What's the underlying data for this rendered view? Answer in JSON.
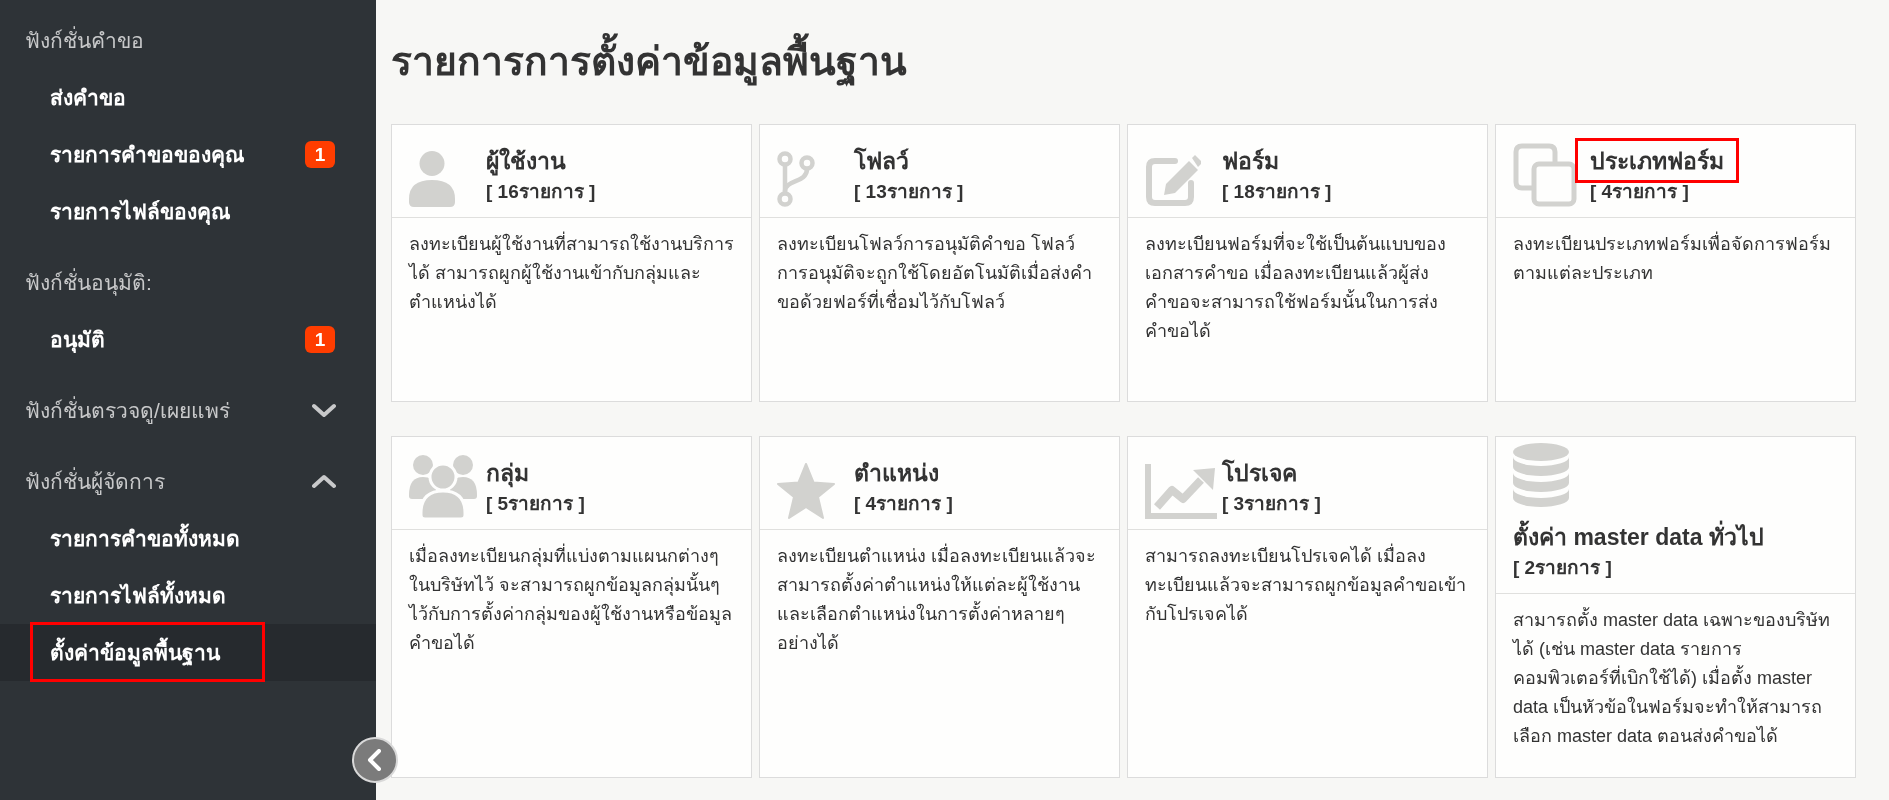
{
  "sidebar": {
    "sections": [
      {
        "kind": "plain",
        "heading": "ฟังก์ชั่นคำขอ",
        "items": [
          {
            "label": "ส่งคำขอ",
            "selected": false,
            "highlighted": false
          },
          {
            "label": "รายการคำขอของคุณ",
            "badge": "1",
            "selected": false,
            "highlighted": false
          },
          {
            "label": "รายการไฟล์ของคุณ",
            "selected": false,
            "highlighted": false
          }
        ]
      },
      {
        "kind": "plain",
        "heading": "ฟังก์ชั่นอนุมัติ:",
        "items": [
          {
            "label": "อนุมัติ",
            "badge": "1",
            "selected": false,
            "highlighted": false
          }
        ]
      },
      {
        "kind": "collapsible",
        "heading": "ฟังก์ชั่นตรวจดู/เผยแพร่",
        "expanded": false
      },
      {
        "kind": "collapsible",
        "heading": "ฟังก์ชั่นผู้จัดการ",
        "expanded": true,
        "items": [
          {
            "label": "รายการคำขอทั้งหมด",
            "selected": false,
            "highlighted": false
          },
          {
            "label": "รายการไฟล์ทั้งหมด",
            "selected": false,
            "highlighted": false
          },
          {
            "label": "ตั้งค่าข้อมูลพื้นฐาน",
            "selected": true,
            "highlighted": true
          }
        ]
      }
    ]
  },
  "page_title": "รายการการตั้งค่าข้อมูลพื้นฐาน",
  "cards": [
    {
      "title": "ผู้ใช้งาน",
      "count": "[ 16รายการ ]",
      "description": "ลงทะเบียนผู้ใช้งานที่สามารถใช้งานบริการได้ สามารถผูกผู้ใช้งานเข้ากับกลุ่มและตำแหน่งได้",
      "highlighted": false
    },
    {
      "title": "โฟลว์",
      "count": "[ 13รายการ ]",
      "description": "ลงทะเบียนโฟลว์การอนุมัติคำขอ โฟลว์การอนุมัติจะถูกใช้โดยอัตโนมัติเมื่อส่งคำขอด้วยฟอร์ที่เชื่อมไว้กับโฟลว์",
      "highlighted": false
    },
    {
      "title": "ฟอร์ม",
      "count": "[ 18รายการ ]",
      "description": "ลงทะเบียนฟอร์มที่จะใช้เป็นต้นแบบของเอกสารคำขอ เมื่อลงทะเบียนแล้วผู้ส่งคำขอจะสามารถใช้ฟอร์มนั้นในการส่งคำขอได้",
      "highlighted": false
    },
    {
      "title": "ประเภทฟอร์ม",
      "count": "[ 4รายการ ]",
      "description": "ลงทะเบียนประเภทฟอร์มเพื่อจัดการฟอร์มตามแต่ละประเภท",
      "highlighted": true
    },
    {
      "title": "กลุ่ม",
      "count": "[ 5รายการ ]",
      "description": "เมื่อลงทะเบียนกลุ่มที่แบ่งตามแผนกต่างๆในบริษัทไว้ จะสามารถผูกข้อมูลกลุ่มนั้นๆไว้กับการตั้งค่ากลุ่มของผู้ใช้งานหรือข้อมูลคำขอได้",
      "highlighted": false
    },
    {
      "title": "ตำแหน่ง",
      "count": "[ 4รายการ ]",
      "description": "ลงทะเบียนตำแหน่ง เมื่อลงทะเบียนแล้วจะสามารถตั้งค่าตำแหน่งให้แต่ละผู้ใช้งานและเลือกตำแหน่งในการตั้งค่าหลายๆอย่างได้",
      "highlighted": false
    },
    {
      "title": "โปรเจค",
      "count": "[ 3รายการ ]",
      "description": "สามารถลงทะเบียนโปรเจคได้ เมื่อลงทะเบียนแล้วจะสามารถผูกข้อมูลคำขอเข้ากับโปรเจคได้",
      "highlighted": false
    },
    {
      "title": "ตั้งค่า master data ทั่วไป",
      "count": "[ 2รายการ ]",
      "description": "สามารถตั้ง master data เฉพาะของบริษัทได้ (เช่น master data รายการคอมพิวเตอร์ที่เบิกใช้ได้) เมื่อตั้ง master data เป็นหัวข้อในฟอร์มจะทำให้สามารถเลือก master data ตอนส่งคำขอได้",
      "highlighted": false
    }
  ]
}
